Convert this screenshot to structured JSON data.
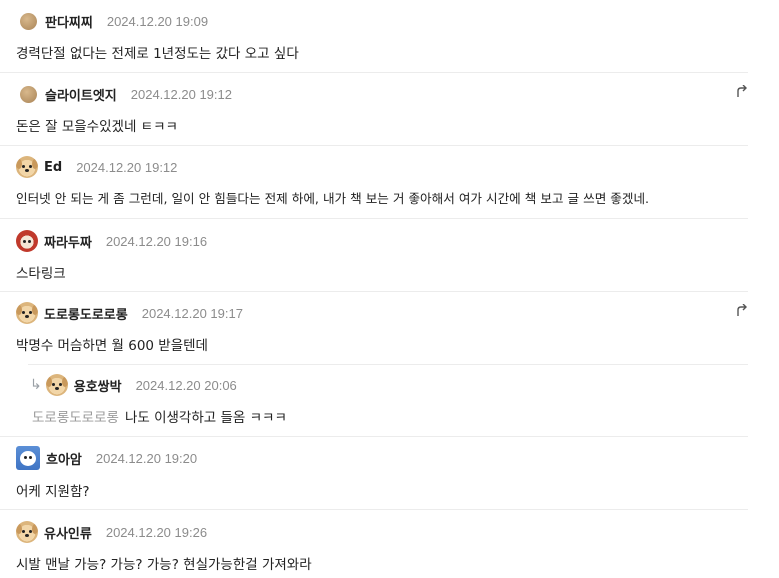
{
  "comments": [
    {
      "nick": "판다찌찌",
      "date": "2024.12.20 19:09",
      "text": "경력단절 없다는 전제로 1년정도는 갔다 오고 싶다"
    },
    {
      "nick": "슬라이트엣지",
      "date": "2024.12.20 19:12",
      "text": "돈은 잘 모을수있겠네 ㅌㅋㅋ"
    },
    {
      "nick": "Ed",
      "date": "2024.12.20 19:12",
      "text": "인터넷 안 되는 게 좀 그런데, 일이 안 힘들다는 전제 하에, 내가 책 보는 거 좋아해서 여가 시간에 책 보고 글 쓰면 좋겠네."
    },
    {
      "nick": "짜라두짜",
      "date": "2024.12.20 19:16",
      "text": "스타링크"
    },
    {
      "nick": "도로롱도로로롱",
      "date": "2024.12.20 19:17",
      "text": "박명수 머슴하면 월 600 받을텐데"
    },
    {
      "nick": "용호쌍박",
      "date": "2024.12.20 20:06",
      "mention": "도로롱도로로롱",
      "text": "나도 이생각하고 들옴 ㅋㅋㅋ"
    },
    {
      "nick": "흐아암",
      "date": "2024.12.20 19:20",
      "text": "어케 지원함?"
    },
    {
      "nick": "유사인류",
      "date": "2024.12.20 19:26",
      "text": "시발 맨날 가능? 가능? 가능? 현실가능한걸 가져와라"
    }
  ],
  "icons": {
    "reply": "reply-arrow-icon",
    "more": "more-icon"
  }
}
